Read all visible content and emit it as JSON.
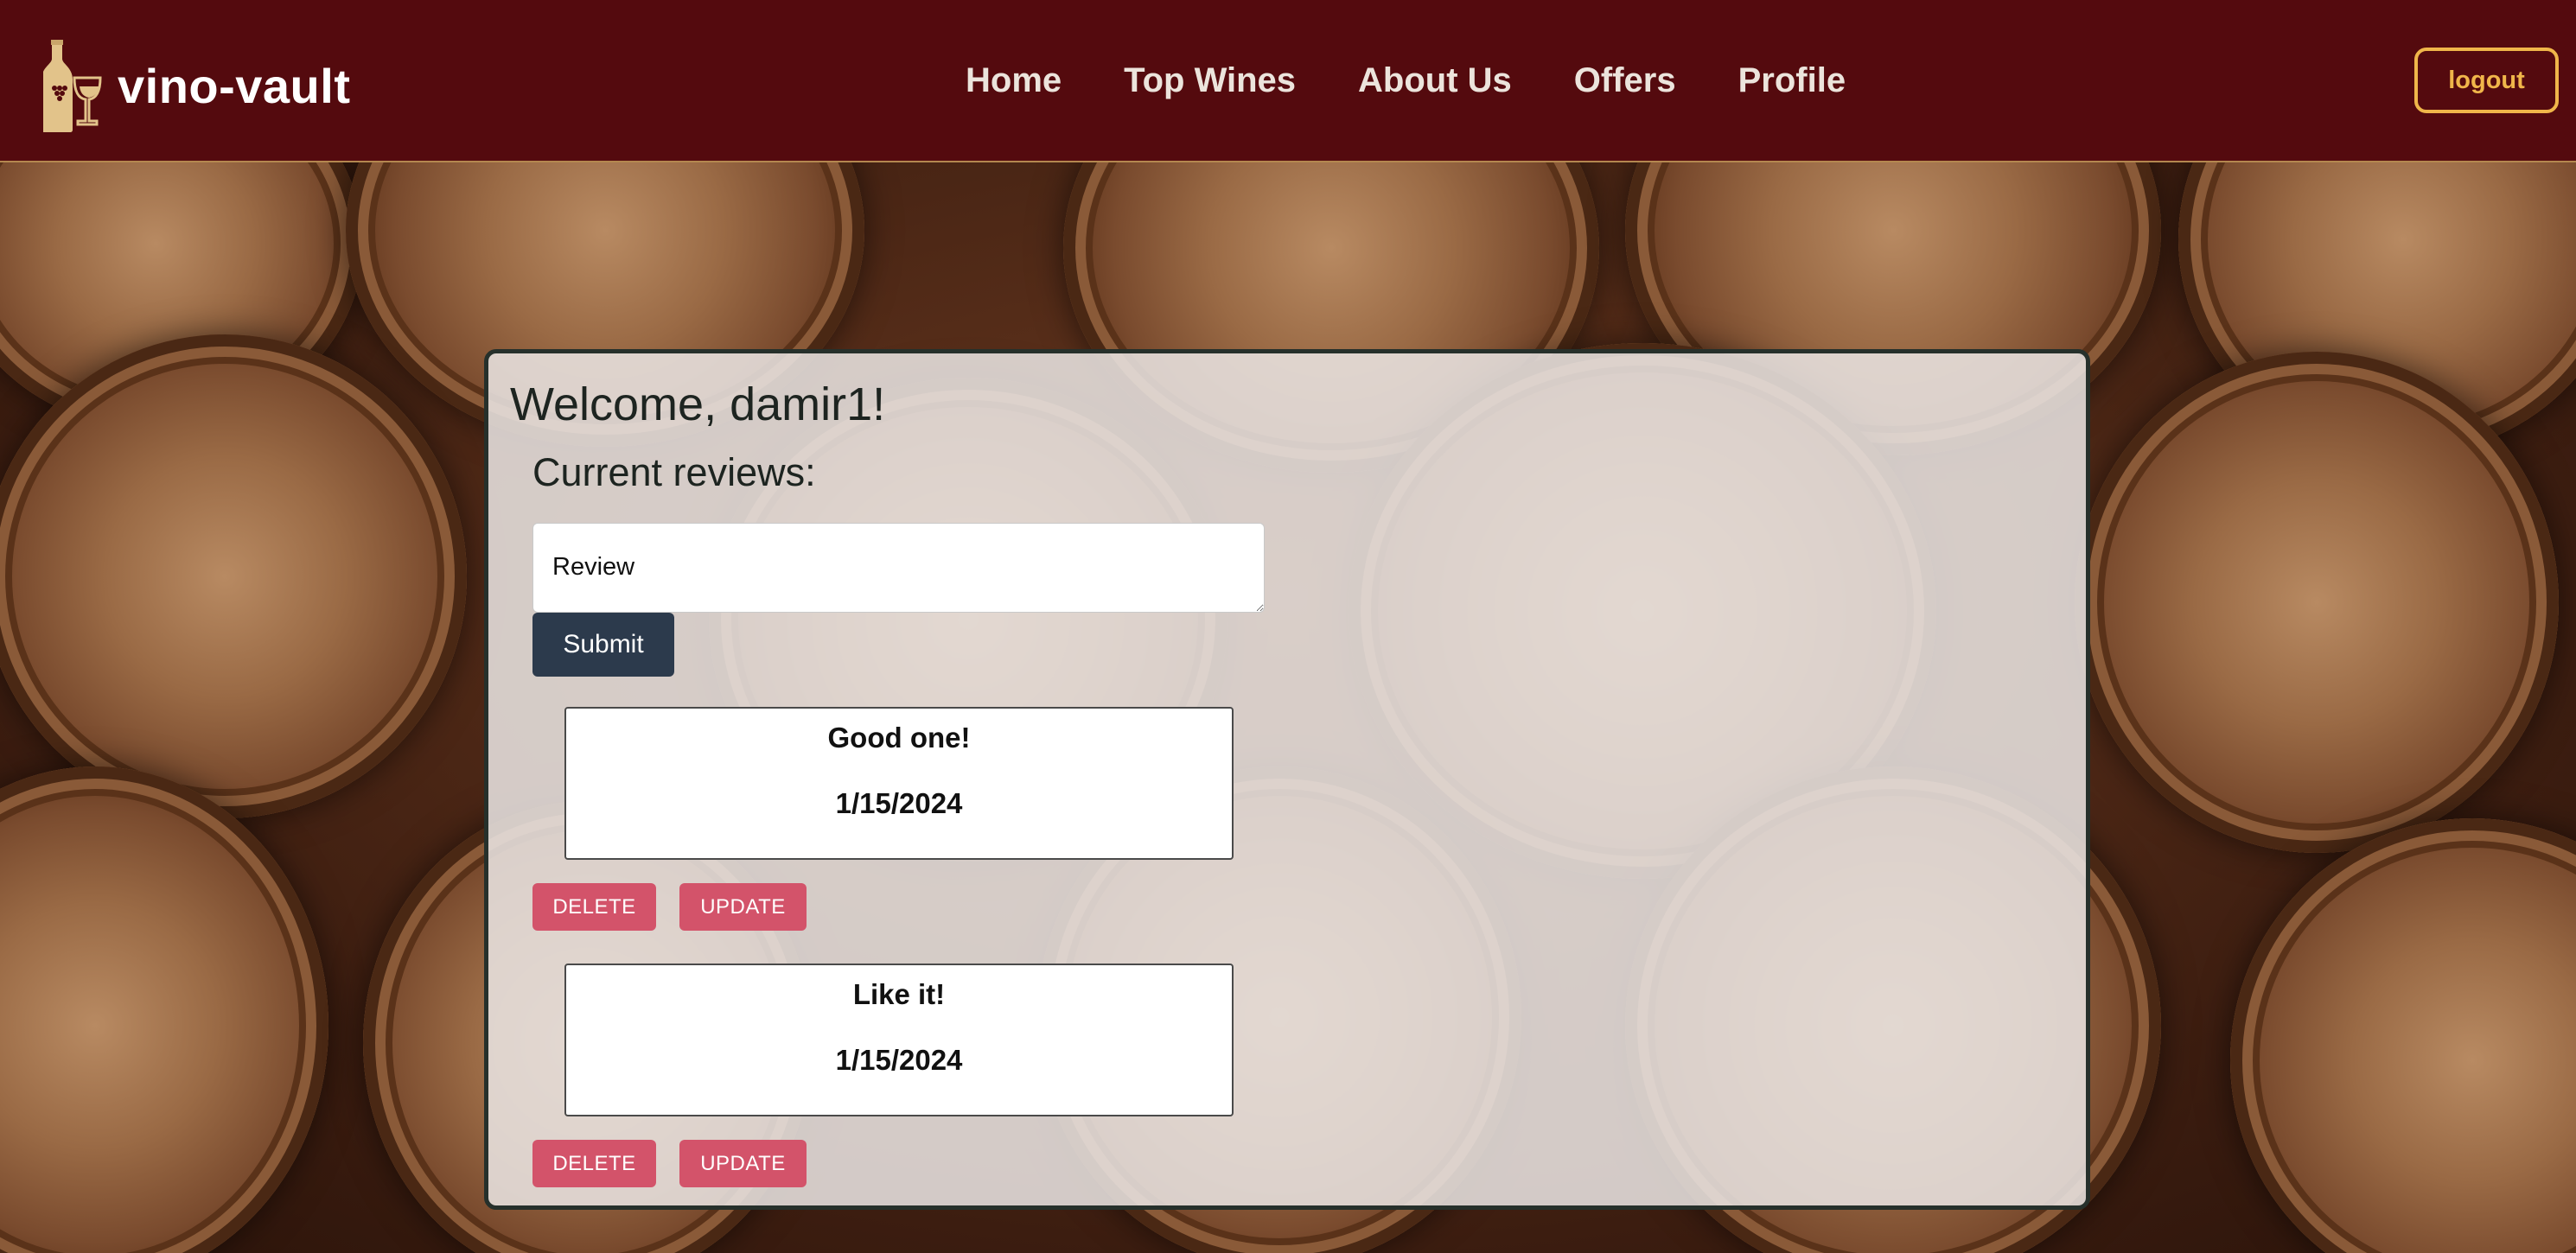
{
  "header": {
    "brand": "vino-vault",
    "brand_icon": "wine-bottle-glass-icon",
    "nav": [
      "Home",
      "Top Wines",
      "About Us",
      "Offers",
      "Profile"
    ],
    "logout_label": "logout"
  },
  "main": {
    "welcome": "Welcome, damir1!",
    "reviews_heading": "Current reviews:",
    "review_placeholder": "Review",
    "submit_label": "Submit",
    "reviews": [
      {
        "text": "Good one!",
        "date": "1/15/2024",
        "delete_label": "DELETE",
        "update_label": "UPDATE"
      },
      {
        "text": "Like it!",
        "date": "1/15/2024",
        "delete_label": "DELETE",
        "update_label": "UPDATE"
      }
    ]
  },
  "colors": {
    "header_bg": "#540a0e",
    "logout_accent": "#f0b64a",
    "submit_bg": "#2c3a4c",
    "action_btn_bg": "#d3536a"
  }
}
